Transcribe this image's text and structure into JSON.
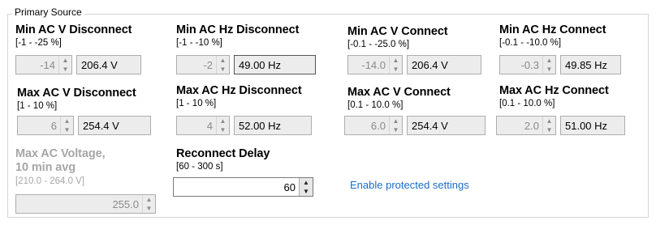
{
  "group": {
    "legend": "Primary Source"
  },
  "row1": [
    {
      "title": "Min AC V Disconnect",
      "range": "[-1 - -25 %]",
      "spin": "-14",
      "readout": "206.4 V"
    },
    {
      "title": "Min AC Hz Disconnect",
      "range": "[-1 - -10 %]",
      "spin": "-2",
      "readout": "49.00 Hz"
    },
    {
      "title": "Min AC V Connect",
      "range": "[-0.1 - -25.0 %]",
      "spin": "-14.0",
      "readout": "206.4 V"
    },
    {
      "title": "Min AC Hz Connect",
      "range": "[-0.1 - -10.0 %]",
      "spin": "-0.3",
      "readout": "49.85 Hz"
    }
  ],
  "row2": [
    {
      "title": "Max AC V Disconnect",
      "range": "[1 - 10 %]",
      "spin": "6",
      "readout": "254.4 V"
    },
    {
      "title": "Max AC Hz Disconnect",
      "range": "[1 - 10 %]",
      "spin": "4",
      "readout": "52.00 Hz"
    },
    {
      "title": "Max AC V Connect",
      "range": "[0.1 - 10.0 %]",
      "spin": "6.0",
      "readout": "254.4 V"
    },
    {
      "title": "Max AC Hz Connect",
      "range": "[0.1 - 10.0 %]",
      "spin": "2.0",
      "readout": "51.00 Hz"
    }
  ],
  "avg": {
    "title_line1": "Max AC Voltage,",
    "title_line2": "10 min avg",
    "range": "[210.0 - 264.0 V]",
    "spin": "255.0"
  },
  "reconnect": {
    "title": "Reconnect Delay",
    "range": "[60 - 300 s]",
    "spin": "60"
  },
  "link": {
    "label": "Enable protected settings"
  },
  "icons": {
    "up": "spin-up-arrow-icon",
    "down": "spin-down-arrow-icon"
  }
}
